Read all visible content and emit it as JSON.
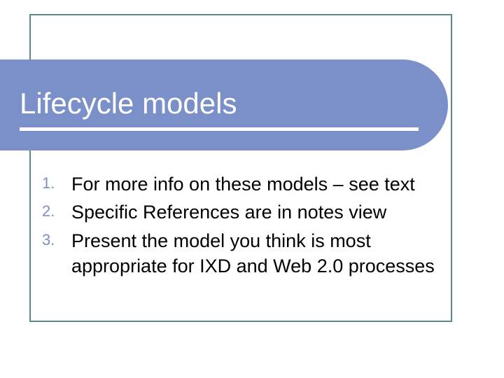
{
  "slide": {
    "title": "Lifecycle models",
    "list_items": [
      "For more info on these models – see text",
      "Specific References are in notes view",
      "Present the model you think is most appropriate for IXD and Web 2.0 processes"
    ]
  }
}
